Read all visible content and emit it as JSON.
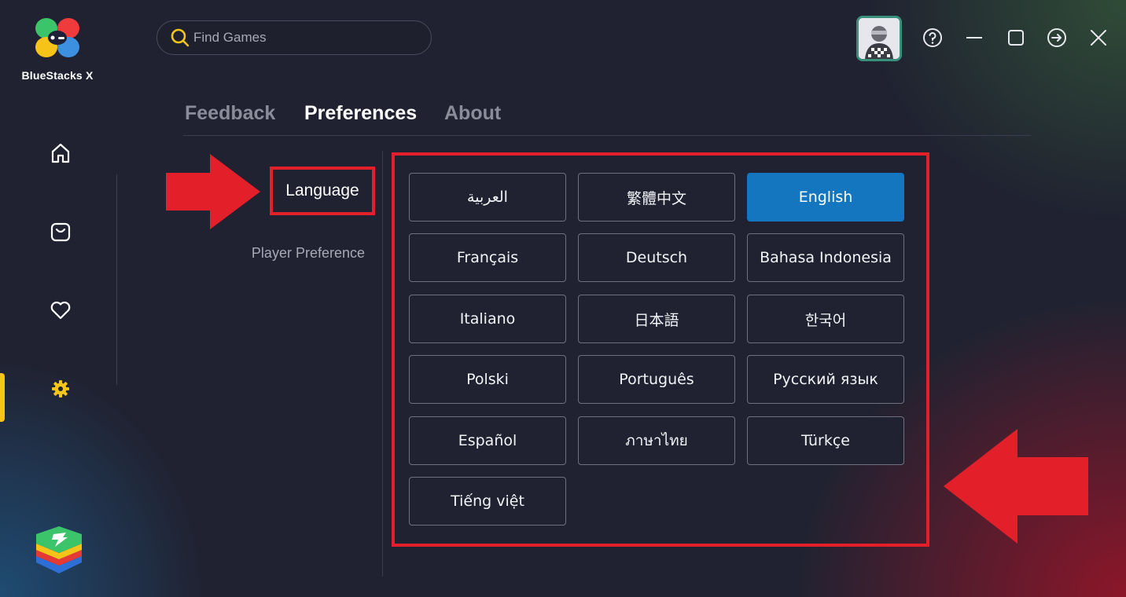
{
  "app": {
    "brand": "BlueStacks X"
  },
  "search": {
    "placeholder": "Find Games",
    "value": ""
  },
  "sidebar": {
    "items": [
      {
        "name": "home",
        "icon": "home-icon"
      },
      {
        "name": "store",
        "icon": "bag-icon"
      },
      {
        "name": "favorites",
        "icon": "heart-icon"
      },
      {
        "name": "settings",
        "icon": "gear-icon",
        "active": true
      }
    ]
  },
  "window_controls": [
    {
      "name": "help",
      "icon": "help-icon"
    },
    {
      "name": "minimize",
      "icon": "minimize-icon"
    },
    {
      "name": "maximize",
      "icon": "maximize-icon"
    },
    {
      "name": "forward",
      "icon": "arrow-right-circle-icon"
    },
    {
      "name": "close",
      "icon": "close-icon"
    }
  ],
  "tabs": [
    {
      "label": "Feedback",
      "active": false
    },
    {
      "label": "Preferences",
      "active": true
    },
    {
      "label": "About",
      "active": false
    }
  ],
  "settings_menu": {
    "language": "Language",
    "player_preference": "Player Preference"
  },
  "languages": [
    {
      "label": "العربية",
      "selected": false
    },
    {
      "label": "繁體中文",
      "selected": false
    },
    {
      "label": "English",
      "selected": true
    },
    {
      "label": "Français",
      "selected": false
    },
    {
      "label": "Deutsch",
      "selected": false
    },
    {
      "label": "Bahasa Indonesia",
      "selected": false
    },
    {
      "label": "Italiano",
      "selected": false
    },
    {
      "label": "日本語",
      "selected": false
    },
    {
      "label": "한국어",
      "selected": false
    },
    {
      "label": "Polski",
      "selected": false
    },
    {
      "label": "Português",
      "selected": false
    },
    {
      "label": "Русский язык",
      "selected": false
    },
    {
      "label": "Español",
      "selected": false
    },
    {
      "label": "ภาษาไทย",
      "selected": false
    },
    {
      "label": "Türkçe",
      "selected": false
    },
    {
      "label": "Tiếng việt",
      "selected": false
    }
  ],
  "colors": {
    "accent_yellow": "#f5c518",
    "selected_blue": "#1476be",
    "annotation_red": "#e3202a",
    "background": "#202231"
  }
}
